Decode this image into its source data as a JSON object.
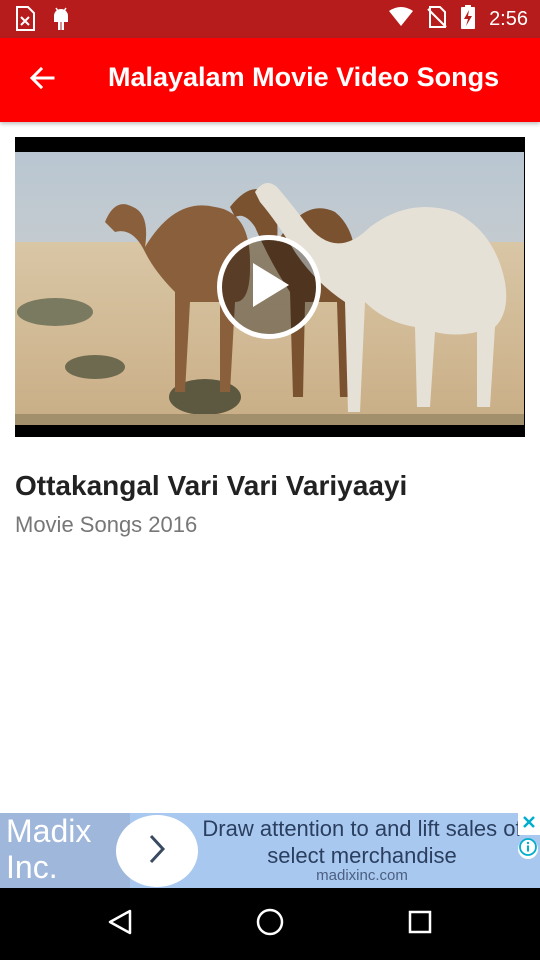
{
  "status_bar": {
    "time": "2:56",
    "icons": [
      "sim-card-icon",
      "android-icon",
      "wifi-icon",
      "no-sim-icon",
      "battery-charging-icon"
    ]
  },
  "app_bar": {
    "back_icon": "arrow-back-icon",
    "title": "Malayalam Movie Video Songs"
  },
  "video": {
    "thumbnail": "camels-in-desert",
    "play_icon": "play-icon",
    "title": "Ottakangal Vari Vari Variyaayi",
    "subtitle": "Movie Songs 2016"
  },
  "ad": {
    "brand": "Madix Inc.",
    "text": "Draw attention to and lift sales of select merchandise",
    "url": "madixinc.com",
    "close_icon": "close-icon",
    "info_icon": "info-icon"
  },
  "nav_bar": {
    "buttons": [
      "back-triangle-icon",
      "home-circle-icon",
      "recents-square-icon"
    ]
  },
  "colors": {
    "status_bar": "#b71c1c",
    "app_bar": "#ff0000",
    "ad_background": "#a9c8f0"
  }
}
